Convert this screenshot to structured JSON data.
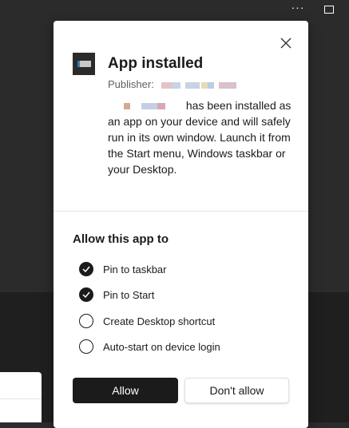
{
  "toolbar": {
    "more_icon": "more-icon",
    "maximize_icon": "maximize-icon"
  },
  "dialog": {
    "title": "App installed",
    "publisher_label": "Publisher:",
    "description": "has been installed as an app on your device and will safely run in its own window. Launch it from the Start menu, Windows taskbar or your Desktop.",
    "close_icon": "close-icon",
    "section_title": "Allow this app to",
    "options": [
      {
        "label": "Pin to taskbar",
        "checked": true
      },
      {
        "label": "Pin to Start",
        "checked": true
      },
      {
        "label": "Create Desktop shortcut",
        "checked": false
      },
      {
        "label": "Auto-start on device login",
        "checked": false
      }
    ],
    "allow_label": "Allow",
    "deny_label": "Don't allow"
  },
  "colors": {
    "accent": "#1b1b1b",
    "background": "#2b2b2b",
    "dialog": "#ffffff"
  }
}
